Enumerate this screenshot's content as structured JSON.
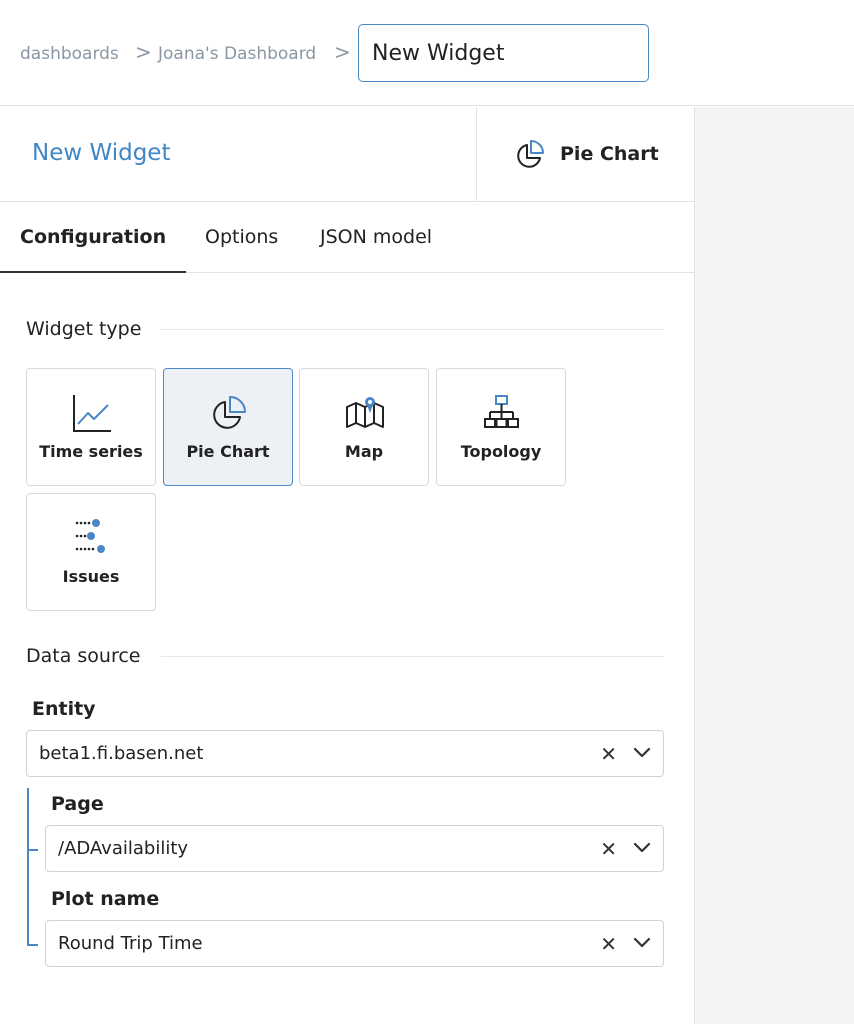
{
  "breadcrumb": {
    "items": [
      "dashboards",
      "Joana's Dashboard"
    ],
    "separator": ">",
    "widget_title_value": "New Widget"
  },
  "panel": {
    "title": "New Widget",
    "type_badge": {
      "icon": "pie-chart-icon",
      "label": "Pie Chart"
    }
  },
  "tabs": [
    {
      "label": "Configuration",
      "active": true
    },
    {
      "label": "Options",
      "active": false
    },
    {
      "label": "JSON model",
      "active": false
    }
  ],
  "widget_type": {
    "label": "Widget type",
    "options": [
      {
        "icon": "line-chart-icon",
        "label": "Time series",
        "selected": false
      },
      {
        "icon": "pie-chart-icon",
        "label": "Pie Chart",
        "selected": true
      },
      {
        "icon": "map-icon",
        "label": "Map",
        "selected": false
      },
      {
        "icon": "topology-icon",
        "label": "Topology",
        "selected": false
      },
      {
        "icon": "issues-icon",
        "label": "Issues",
        "selected": false
      }
    ]
  },
  "data_source": {
    "label": "Data source",
    "entity": {
      "label": "Entity",
      "value": "beta1.fi.basen.net"
    },
    "page": {
      "label": "Page",
      "value": "/ADAvailability"
    },
    "plot_name": {
      "label": "Plot name",
      "value": "Round Trip Time"
    },
    "clear_glyph": "✕"
  },
  "colors": {
    "accent": "#4a87c5",
    "selected_card_bg": "#edf1f6",
    "border": "#d9d9d9",
    "breadcrumb_text": "#8a96a3"
  }
}
